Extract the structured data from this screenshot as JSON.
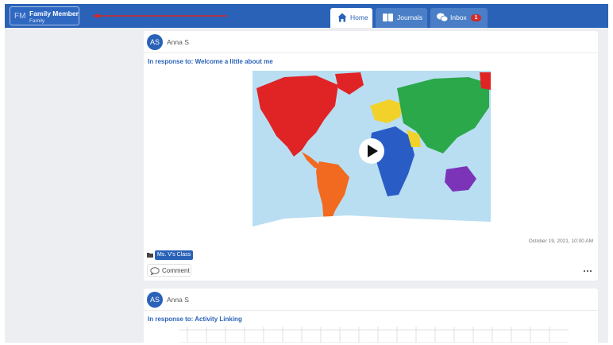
{
  "header": {
    "user": {
      "initials": "FM",
      "name": "Family Member",
      "role": "Family"
    },
    "tabs": [
      {
        "label": "Home",
        "icon": "home-icon",
        "active": true
      },
      {
        "label": "Journals",
        "icon": "book-icon",
        "active": false
      },
      {
        "label": "Inbox",
        "icon": "chat-bubbles-icon",
        "active": false,
        "badge": "1"
      }
    ],
    "colors": {
      "brand": "#2a62b8",
      "annotation_arrow": "#d62828",
      "badge": "#d22b2b"
    }
  },
  "posts": [
    {
      "author": {
        "initials": "AS",
        "name": "Anna S"
      },
      "response_to": "In response to: Welcome a little about me",
      "media": {
        "kind": "video",
        "icon": "play-icon",
        "thumbnail": "world map"
      },
      "timestamp": "October 19, 2021, 10:00 AM",
      "class_tag": "Ms. V's Class",
      "comment_label": "Comment"
    },
    {
      "author": {
        "initials": "AS",
        "name": "Anna S"
      },
      "response_to": "In response to: Activity Linking"
    }
  ]
}
